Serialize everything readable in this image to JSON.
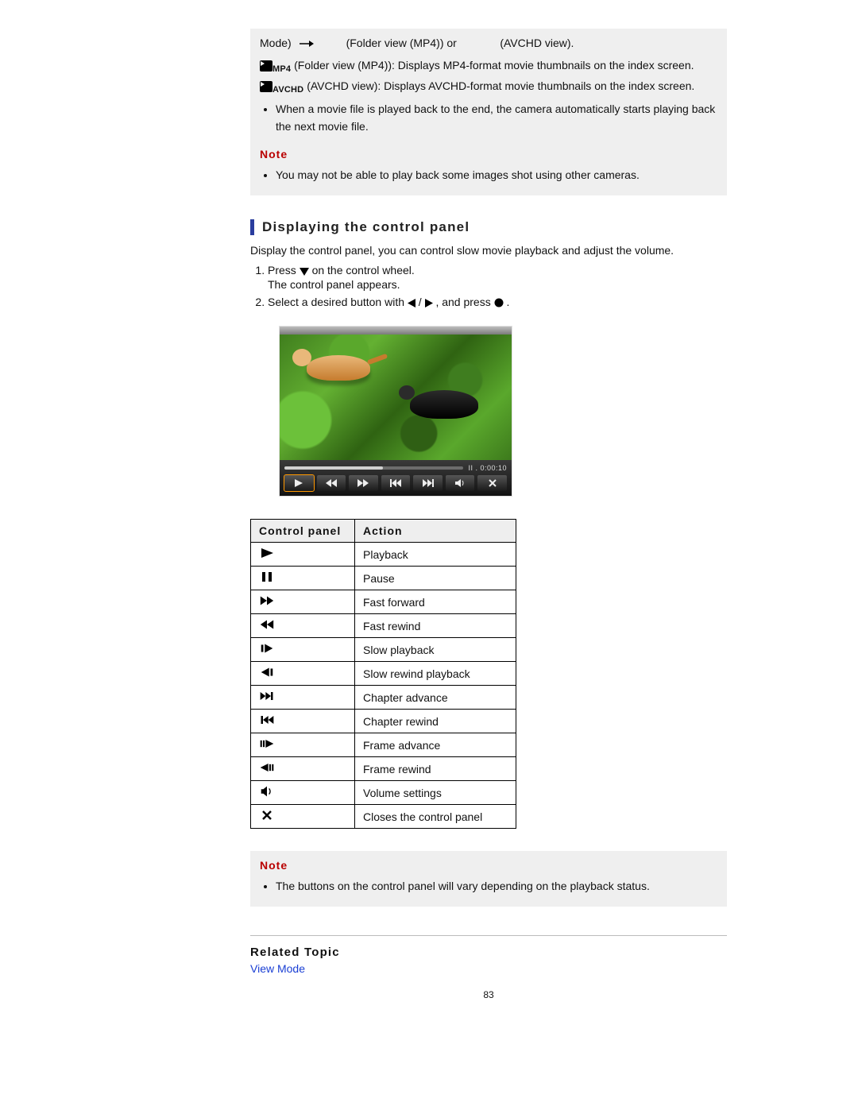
{
  "top": {
    "mode_paren": "Mode)",
    "label_mp4_or": "(Folder view (MP4)) or",
    "label_avchd": "(AVCHD view).",
    "mp4_desc": "(Folder view (MP4)): Displays MP4-format movie thumbnails on the index screen.",
    "avchd_desc": "(AVCHD view): Displays AVCHD-format movie thumbnails on the index screen.",
    "autoplay": "When a movie file is played back to the end, the camera automatically starts playing back the next movie file.",
    "note_label": "Note",
    "note_item": "You may not be able to play back some images shot using other cameras."
  },
  "sec": {
    "heading": "Displaying the control panel",
    "lead": "Display the control panel, you can control slow movie playback and adjust the volume.",
    "step1a": "Press ",
    "step1b": " on the control wheel.",
    "step1c": "The control panel appears.",
    "step2a": "Select a desired button with ",
    "step2b": " / ",
    "step2c": " , and press ",
    "step2d": " ."
  },
  "preview": {
    "time": "II . 0:00:10"
  },
  "table": {
    "h1": "Control panel",
    "h2": "Action",
    "rows": [
      "Playback",
      "Pause",
      "Fast forward",
      "Fast rewind",
      "Slow playback",
      "Slow rewind playback",
      "Chapter advance",
      "Chapter rewind",
      "Frame advance",
      "Frame rewind",
      "Volume settings",
      "Closes the control panel"
    ]
  },
  "note2": {
    "label": "Note",
    "item": "The buttons on the control panel will vary depending on the playback status."
  },
  "related": {
    "heading": "Related Topic",
    "link": "View Mode"
  },
  "page_number": "83",
  "badges": {
    "mp4": "MP4",
    "avchd": "AVCHD"
  }
}
